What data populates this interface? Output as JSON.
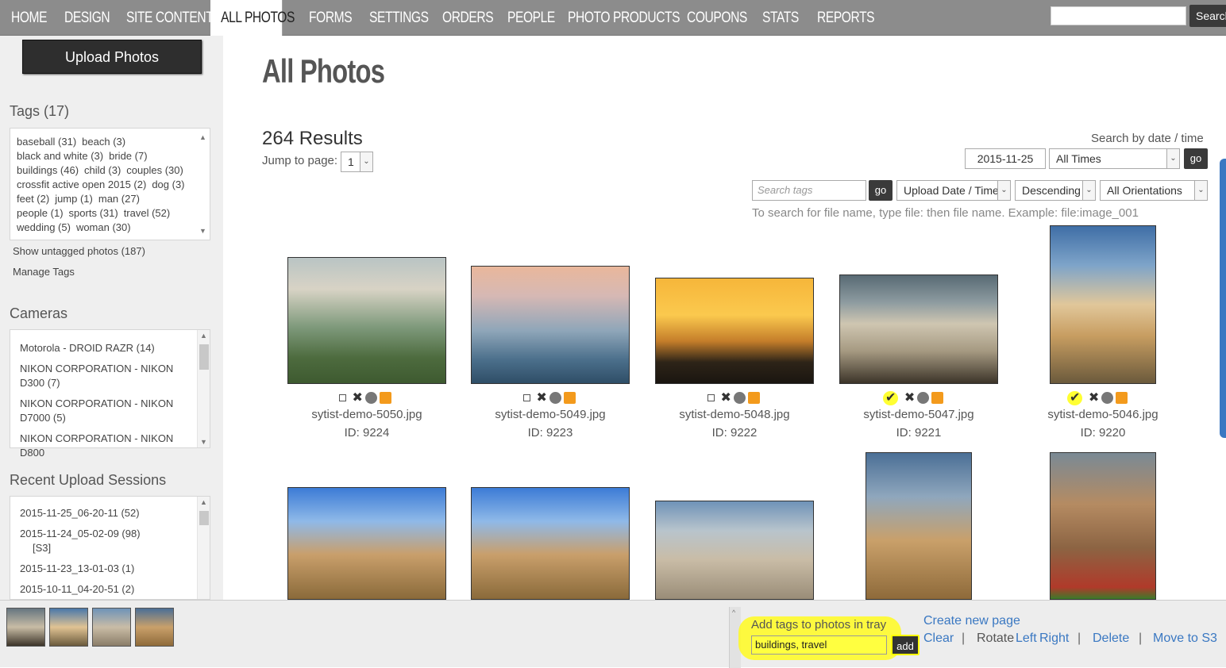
{
  "nav": {
    "items": [
      "HOME",
      "DESIGN",
      "SITE CONTENT",
      "ALL PHOTOS",
      "FORMS",
      "SETTINGS",
      "ORDERS",
      "PEOPLE",
      "PHOTO PRODUCTS",
      "COUPONS",
      "STATS",
      "REPORTS"
    ],
    "active": "ALL PHOTOS",
    "search_button": "Search"
  },
  "sidebar": {
    "upload_button": "Upload Photos",
    "tags_heading": "Tags (17)",
    "tags": [
      "baseball (31)",
      "beach (3)",
      "black and white (3)",
      "bride (7)",
      "buildings (46)",
      "child (3)",
      "couples (30)",
      "crossfit active open 2015 (2)",
      "dog (3)",
      "feet (2)",
      "jump (1)",
      "man (27)",
      "people (1)",
      "sports (31)",
      "travel (52)",
      "wedding (5)",
      "woman (30)"
    ],
    "show_untagged": "Show untagged photos (187)",
    "manage_tags": "Manage Tags",
    "cameras_heading": "Cameras",
    "cameras": [
      "Motorola - DROID RAZR (14)",
      "NIKON CORPORATION - NIKON D300 (7)",
      "NIKON CORPORATION - NIKON D7000 (5)",
      "NIKON CORPORATION - NIKON D800"
    ],
    "sessions_heading": "Recent Upload Sessions",
    "sessions": [
      "2015-11-25_06-20-11 (52)",
      "2015-11-24_05-02-09 (98)",
      "[S3]",
      "2015-11-23_13-01-03 (1)",
      "2015-10-11_04-20-51 (2)"
    ]
  },
  "main": {
    "title": "All Photos",
    "results": "264 Results",
    "jump_label": "Jump to page:",
    "jump_value": "1",
    "search_by_label": "Search by date / time",
    "date_value": "2015-11-25",
    "time_select": "All Times",
    "go": "go",
    "tags_placeholder": "Search tags",
    "sort_select": "Upload Date / Time",
    "order_select": "Descending",
    "orientation_select": "All Orientations",
    "hint": "To search for file name, type file: then file name. Example: file:image_001"
  },
  "photos": [
    {
      "file": "sytist-demo-5050.jpg",
      "id": "ID: 9224",
      "checked": false
    },
    {
      "file": "sytist-demo-5049.jpg",
      "id": "ID: 9223",
      "checked": false
    },
    {
      "file": "sytist-demo-5048.jpg",
      "id": "ID: 9222",
      "checked": false
    },
    {
      "file": "sytist-demo-5047.jpg",
      "id": "ID: 9221",
      "checked": true
    },
    {
      "file": "sytist-demo-5046.jpg",
      "id": "ID: 9220",
      "checked": true
    }
  ],
  "tray": {
    "label": "Add tags to photos in tray",
    "input_value": "buildings, travel",
    "add_button": "add",
    "create_page": "Create new page",
    "clear": "Clear",
    "rotate": "Rotate",
    "left": "Left",
    "right": "Right",
    "delete": "Delete",
    "move_s3": "Move to S3"
  },
  "colors": {
    "nav_bg": "#8c8c8c",
    "link": "#3a78c2",
    "highlight": "#ffff33",
    "icon_orange": "#f39a1c"
  }
}
